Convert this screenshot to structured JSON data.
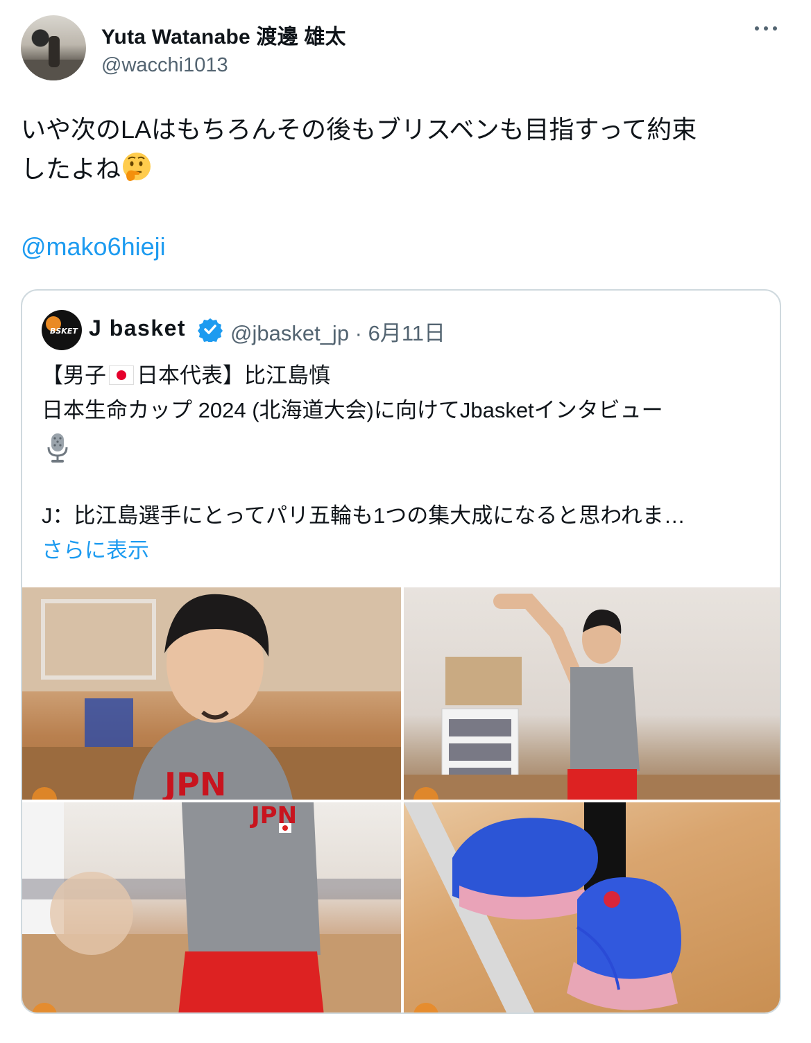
{
  "author": {
    "display_name": "Yuta Watanabe 渡邊 雄太",
    "handle": "@wacchi1013"
  },
  "tweet": {
    "lines": [
      "いや次のLAはもちろんその後もブリスベンも目指すって約束",
      "したよね"
    ],
    "emoji": "thinking-face",
    "mention": "@mako6hieji"
  },
  "quote": {
    "author_name": "J basket",
    "handle_date": "@jbasket_jp · 6月11日",
    "line1_a": "【男子",
    "line1_b": "日本代表】比江島慎",
    "line2": "日本生命カップ 2024 (北海道大会)に向けてJbasketインタビュー",
    "line4": "J：比江島選手にとってパリ五輪も1つの集大成になると思われま…",
    "show_more": "さらに表示",
    "verified_color": "#1d9bf0"
  },
  "colors": {
    "link": "#1d9bf0",
    "secondary": "#536471",
    "border": "#cfd9de"
  }
}
